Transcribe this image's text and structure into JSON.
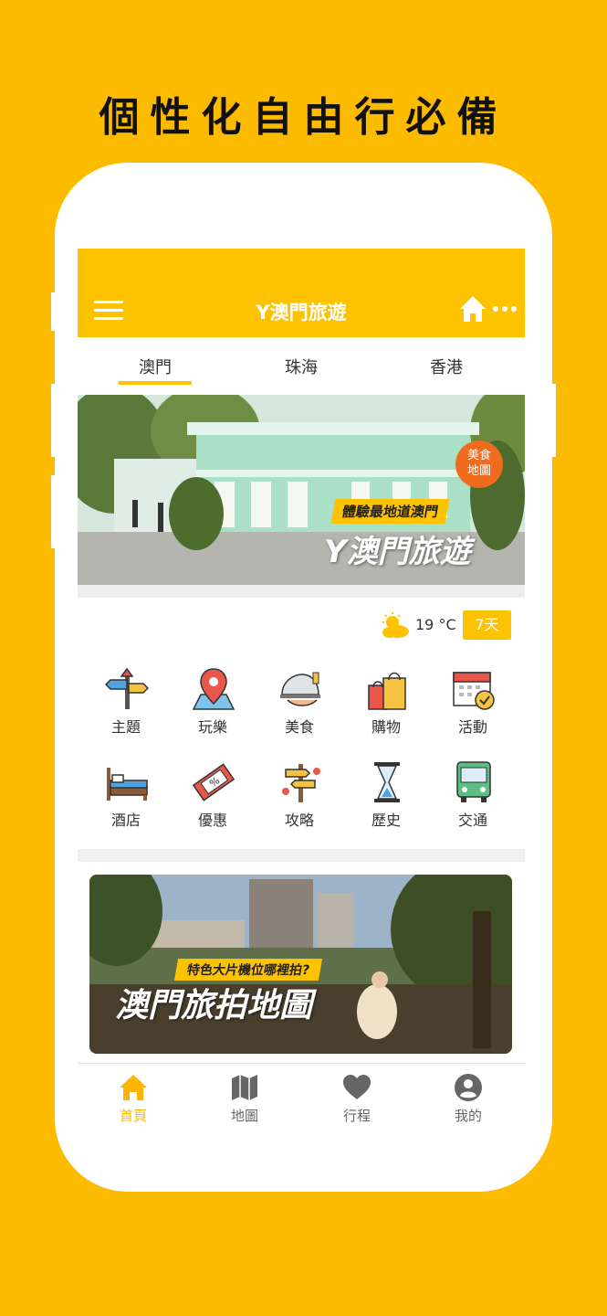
{
  "headline": "個性化自由行必備",
  "app": {
    "title": "Y澳門旅遊",
    "accent_color": "#fdc300"
  },
  "tabs": [
    {
      "label": "澳門",
      "selected": true
    },
    {
      "label": "珠海",
      "selected": false
    },
    {
      "label": "香港",
      "selected": false
    }
  ],
  "banner": {
    "badge": "美食\n地圖",
    "tagline": "體驗最地道澳門",
    "title": "Y澳門旅遊"
  },
  "weather": {
    "icon": "partly-cloudy-sun-icon",
    "temperature": "19 °C",
    "forecast_button": "7天"
  },
  "categories": [
    {
      "label": "主題",
      "icon": "direction-signs-icon"
    },
    {
      "label": "玩樂",
      "icon": "map-pin-icon"
    },
    {
      "label": "美食",
      "icon": "food-dish-icon"
    },
    {
      "label": "購物",
      "icon": "shopping-bags-icon"
    },
    {
      "label": "活動",
      "icon": "calendar-check-icon"
    },
    {
      "label": "酒店",
      "icon": "bed-icon"
    },
    {
      "label": "優惠",
      "icon": "coupon-ticket-icon"
    },
    {
      "label": "攻略",
      "icon": "signpost-icon"
    },
    {
      "label": "歷史",
      "icon": "hourglass-icon"
    },
    {
      "label": "交通",
      "icon": "bus-icon"
    }
  ],
  "promo": {
    "tagline": "特色大片機位哪裡拍?",
    "title": "澳門旅拍地圖"
  },
  "bottom_nav": [
    {
      "label": "首頁",
      "icon": "home-icon",
      "active": true
    },
    {
      "label": "地圖",
      "icon": "map-icon",
      "active": false
    },
    {
      "label": "行程",
      "icon": "heart-icon",
      "active": false
    },
    {
      "label": "我的",
      "icon": "user-icon",
      "active": false
    }
  ]
}
